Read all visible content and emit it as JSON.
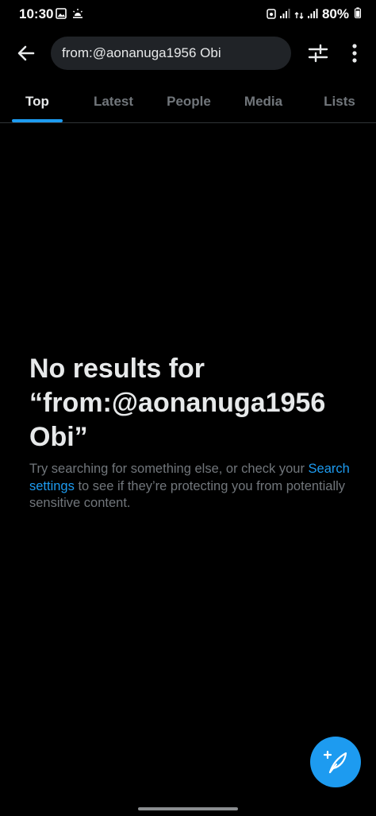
{
  "status_bar": {
    "time": "10:30",
    "battery": "80%"
  },
  "search": {
    "query": "from:@aonanuga1956 Obi"
  },
  "tabs": [
    {
      "label": "Top"
    },
    {
      "label": "Latest"
    },
    {
      "label": "People"
    },
    {
      "label": "Media"
    },
    {
      "label": "Lists"
    }
  ],
  "active_tab": "Top",
  "empty_state": {
    "title": "No results for “from:@aonanuga1956 Obi”",
    "subtitle_before": "Try searching for something else, or check your ",
    "link": "Search settings",
    "subtitle_after": " to see if they’re protecting you from potentially sensitive content."
  },
  "colors": {
    "background": "#000000",
    "accent": "#1d9bf0",
    "muted": "#71767b",
    "text": "#e7e9ea"
  },
  "icons": [
    "back-arrow-icon",
    "filter-sliders-icon",
    "more-vertical-icon",
    "compose-tweet-icon"
  ]
}
